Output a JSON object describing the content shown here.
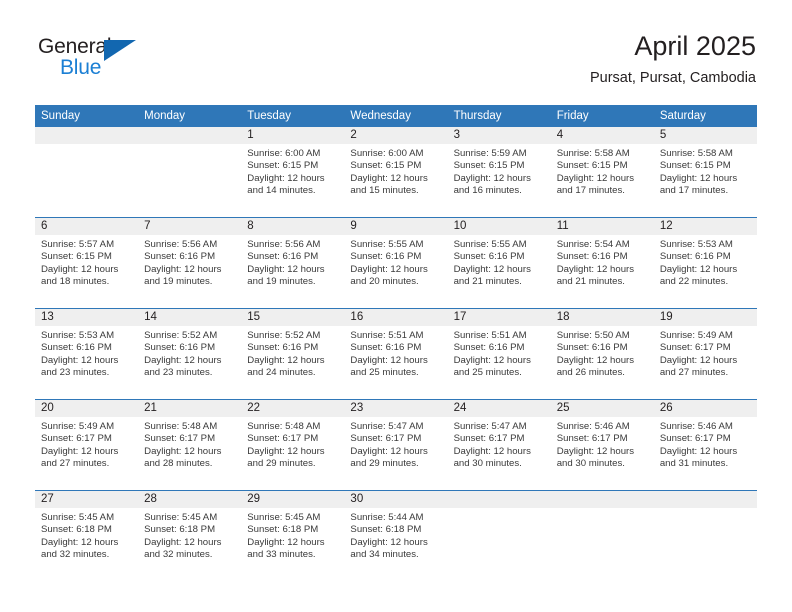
{
  "brand": {
    "name_part1": "General",
    "name_part2": "Blue",
    "logo_icon": "triangle-icon"
  },
  "header": {
    "title": "April 2025",
    "subtitle": "Pursat, Pursat, Cambodia"
  },
  "calendar": {
    "accent_color": "#2f77b8",
    "daynum_band_color": "#efefef",
    "weekday_headers": [
      "Sunday",
      "Monday",
      "Tuesday",
      "Wednesday",
      "Thursday",
      "Friday",
      "Saturday"
    ],
    "weeks": [
      [
        {
          "day": "",
          "lines": []
        },
        {
          "day": "",
          "lines": []
        },
        {
          "day": "1",
          "lines": [
            "Sunrise: 6:00 AM",
            "Sunset: 6:15 PM",
            "Daylight: 12 hours",
            "and 14 minutes."
          ]
        },
        {
          "day": "2",
          "lines": [
            "Sunrise: 6:00 AM",
            "Sunset: 6:15 PM",
            "Daylight: 12 hours",
            "and 15 minutes."
          ]
        },
        {
          "day": "3",
          "lines": [
            "Sunrise: 5:59 AM",
            "Sunset: 6:15 PM",
            "Daylight: 12 hours",
            "and 16 minutes."
          ]
        },
        {
          "day": "4",
          "lines": [
            "Sunrise: 5:58 AM",
            "Sunset: 6:15 PM",
            "Daylight: 12 hours",
            "and 17 minutes."
          ]
        },
        {
          "day": "5",
          "lines": [
            "Sunrise: 5:58 AM",
            "Sunset: 6:15 PM",
            "Daylight: 12 hours",
            "and 17 minutes."
          ]
        }
      ],
      [
        {
          "day": "6",
          "lines": [
            "Sunrise: 5:57 AM",
            "Sunset: 6:15 PM",
            "Daylight: 12 hours",
            "and 18 minutes."
          ]
        },
        {
          "day": "7",
          "lines": [
            "Sunrise: 5:56 AM",
            "Sunset: 6:16 PM",
            "Daylight: 12 hours",
            "and 19 minutes."
          ]
        },
        {
          "day": "8",
          "lines": [
            "Sunrise: 5:56 AM",
            "Sunset: 6:16 PM",
            "Daylight: 12 hours",
            "and 19 minutes."
          ]
        },
        {
          "day": "9",
          "lines": [
            "Sunrise: 5:55 AM",
            "Sunset: 6:16 PM",
            "Daylight: 12 hours",
            "and 20 minutes."
          ]
        },
        {
          "day": "10",
          "lines": [
            "Sunrise: 5:55 AM",
            "Sunset: 6:16 PM",
            "Daylight: 12 hours",
            "and 21 minutes."
          ]
        },
        {
          "day": "11",
          "lines": [
            "Sunrise: 5:54 AM",
            "Sunset: 6:16 PM",
            "Daylight: 12 hours",
            "and 21 minutes."
          ]
        },
        {
          "day": "12",
          "lines": [
            "Sunrise: 5:53 AM",
            "Sunset: 6:16 PM",
            "Daylight: 12 hours",
            "and 22 minutes."
          ]
        }
      ],
      [
        {
          "day": "13",
          "lines": [
            "Sunrise: 5:53 AM",
            "Sunset: 6:16 PM",
            "Daylight: 12 hours",
            "and 23 minutes."
          ]
        },
        {
          "day": "14",
          "lines": [
            "Sunrise: 5:52 AM",
            "Sunset: 6:16 PM",
            "Daylight: 12 hours",
            "and 23 minutes."
          ]
        },
        {
          "day": "15",
          "lines": [
            "Sunrise: 5:52 AM",
            "Sunset: 6:16 PM",
            "Daylight: 12 hours",
            "and 24 minutes."
          ]
        },
        {
          "day": "16",
          "lines": [
            "Sunrise: 5:51 AM",
            "Sunset: 6:16 PM",
            "Daylight: 12 hours",
            "and 25 minutes."
          ]
        },
        {
          "day": "17",
          "lines": [
            "Sunrise: 5:51 AM",
            "Sunset: 6:16 PM",
            "Daylight: 12 hours",
            "and 25 minutes."
          ]
        },
        {
          "day": "18",
          "lines": [
            "Sunrise: 5:50 AM",
            "Sunset: 6:16 PM",
            "Daylight: 12 hours",
            "and 26 minutes."
          ]
        },
        {
          "day": "19",
          "lines": [
            "Sunrise: 5:49 AM",
            "Sunset: 6:17 PM",
            "Daylight: 12 hours",
            "and 27 minutes."
          ]
        }
      ],
      [
        {
          "day": "20",
          "lines": [
            "Sunrise: 5:49 AM",
            "Sunset: 6:17 PM",
            "Daylight: 12 hours",
            "and 27 minutes."
          ]
        },
        {
          "day": "21",
          "lines": [
            "Sunrise: 5:48 AM",
            "Sunset: 6:17 PM",
            "Daylight: 12 hours",
            "and 28 minutes."
          ]
        },
        {
          "day": "22",
          "lines": [
            "Sunrise: 5:48 AM",
            "Sunset: 6:17 PM",
            "Daylight: 12 hours",
            "and 29 minutes."
          ]
        },
        {
          "day": "23",
          "lines": [
            "Sunrise: 5:47 AM",
            "Sunset: 6:17 PM",
            "Daylight: 12 hours",
            "and 29 minutes."
          ]
        },
        {
          "day": "24",
          "lines": [
            "Sunrise: 5:47 AM",
            "Sunset: 6:17 PM",
            "Daylight: 12 hours",
            "and 30 minutes."
          ]
        },
        {
          "day": "25",
          "lines": [
            "Sunrise: 5:46 AM",
            "Sunset: 6:17 PM",
            "Daylight: 12 hours",
            "and 30 minutes."
          ]
        },
        {
          "day": "26",
          "lines": [
            "Sunrise: 5:46 AM",
            "Sunset: 6:17 PM",
            "Daylight: 12 hours",
            "and 31 minutes."
          ]
        }
      ],
      [
        {
          "day": "27",
          "lines": [
            "Sunrise: 5:45 AM",
            "Sunset: 6:18 PM",
            "Daylight: 12 hours",
            "and 32 minutes."
          ]
        },
        {
          "day": "28",
          "lines": [
            "Sunrise: 5:45 AM",
            "Sunset: 6:18 PM",
            "Daylight: 12 hours",
            "and 32 minutes."
          ]
        },
        {
          "day": "29",
          "lines": [
            "Sunrise: 5:45 AM",
            "Sunset: 6:18 PM",
            "Daylight: 12 hours",
            "and 33 minutes."
          ]
        },
        {
          "day": "30",
          "lines": [
            "Sunrise: 5:44 AM",
            "Sunset: 6:18 PM",
            "Daylight: 12 hours",
            "and 34 minutes."
          ]
        },
        {
          "day": "",
          "lines": []
        },
        {
          "day": "",
          "lines": []
        },
        {
          "day": "",
          "lines": []
        }
      ]
    ]
  }
}
